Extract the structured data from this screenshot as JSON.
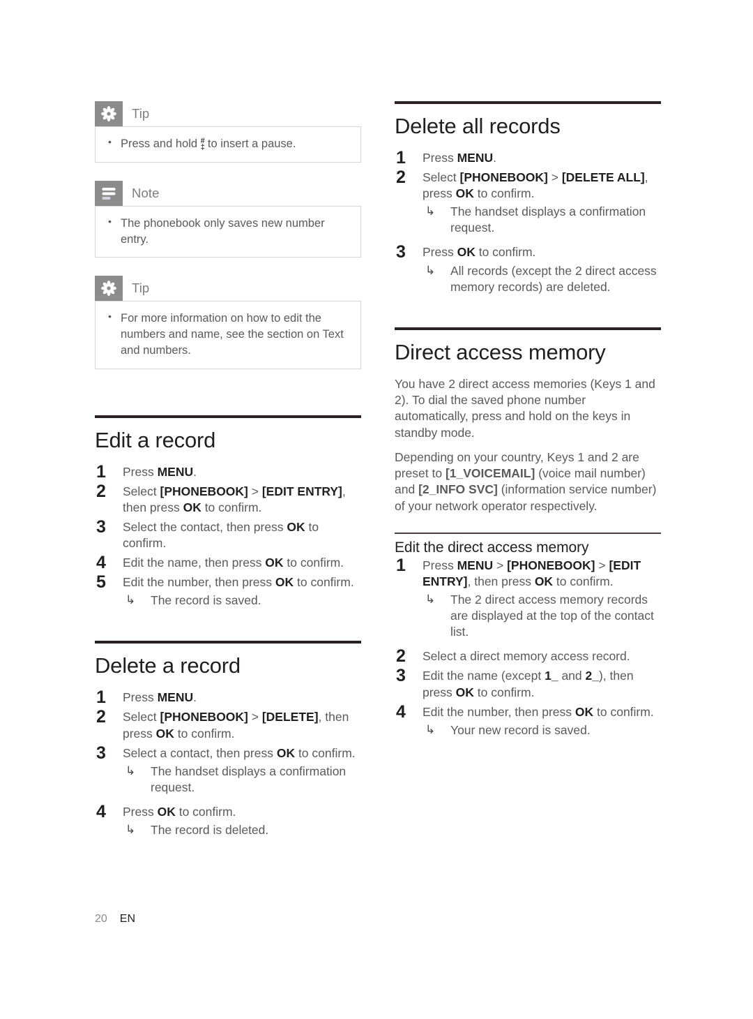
{
  "page": {
    "number": "20",
    "language": "EN"
  },
  "callouts": [
    {
      "icon": "tip-asterisk-icon",
      "type": "Tip",
      "items": [
        {
          "pre": "Press and hold ",
          "key_top": "#",
          "key_bottom": "‡",
          "post": " to insert a pause."
        }
      ]
    },
    {
      "icon": "note-lines-icon",
      "type": "Note",
      "items": [
        {
          "text": "The phonebook only saves new number entry."
        }
      ]
    },
    {
      "icon": "tip-asterisk-icon",
      "type": "Tip",
      "items": [
        {
          "text": "For more information on how to edit the numbers and name, see the section on Text and numbers."
        }
      ]
    }
  ],
  "sections": {
    "edit_a_record": {
      "title": "Edit a record",
      "steps": [
        {
          "num": "1",
          "html": "Press <b>MENU</b>."
        },
        {
          "num": "2",
          "html": "Select <b>[PHONEBOOK]</b> &gt; <b>[EDIT ENTRY]</b>, then press <b>OK</b> to confirm."
        },
        {
          "num": "3",
          "html": "Select the contact, then press <b>OK</b> to confirm."
        },
        {
          "num": "4",
          "html": "Edit the name, then press <b>OK</b> to confirm."
        },
        {
          "num": "5",
          "html": "Edit the number, then press <b>OK</b> to confirm.",
          "result": "The record is saved."
        }
      ]
    },
    "delete_a_record": {
      "title": "Delete a record",
      "steps": [
        {
          "num": "1",
          "html": "Press <b>MENU</b>."
        },
        {
          "num": "2",
          "html": "Select <b>[PHONEBOOK]</b> &gt; <b>[DELETE]</b>, then press <b>OK</b> to confirm."
        },
        {
          "num": "3",
          "html": "Select a contact, then press <b>OK</b> to confirm.",
          "result": "The handset displays a confirmation request."
        },
        {
          "num": "4",
          "html": "Press <b>OK</b> to confirm.",
          "result": "The record is deleted."
        }
      ]
    },
    "delete_all_records": {
      "title": "Delete all records",
      "steps": [
        {
          "num": "1",
          "html": "Press <b>MENU</b>."
        },
        {
          "num": "2",
          "html": "Select <b>[PHONEBOOK]</b> &gt; <b>[DELETE ALL]</b>, press <b>OK</b> to confirm.",
          "result": "The handset displays a confirmation request."
        },
        {
          "num": "3",
          "html": "Press <b>OK</b> to confirm.",
          "result": "All records (except the 2 direct access memory records) are deleted."
        }
      ]
    },
    "direct_access_memory": {
      "title": "Direct access memory",
      "paragraphs": [
        "You have 2 direct access memories (Keys 1 and 2). To dial the saved phone number automatically, press and hold on the keys in standby mode.",
        "Depending on your country, Keys 1 and 2 are preset to <b>[1_VOICEMAIL]</b> (voice mail number) and <b>[2_INFO SVC]</b> (information service number) of your network operator respectively."
      ],
      "subsection": {
        "title": "Edit the direct access memory",
        "steps": [
          {
            "num": "1",
            "html": "Press <b>MENU</b> &gt; <b>[PHONEBOOK]</b> &gt; <b>[EDIT ENTRY]</b>, then press <b>OK</b> to confirm.",
            "result": "The 2 direct access memory records are displayed at the top of the contact list."
          },
          {
            "num": "2",
            "html": "Select a direct memory access record."
          },
          {
            "num": "3",
            "html": "Edit the name (except <b>1_</b> and <b>2_</b>), then press <b>OK</b> to confirm."
          },
          {
            "num": "4",
            "html": "Edit the number, then press <b>OK</b> to confirm.",
            "result": "Your new record is saved."
          }
        ]
      }
    }
  },
  "colors": {
    "rule": "#2b2127",
    "heading": "#231f20",
    "body": "#5a5a5a",
    "badge": "#8c8c8c",
    "box_border": "#d8d8d8"
  }
}
